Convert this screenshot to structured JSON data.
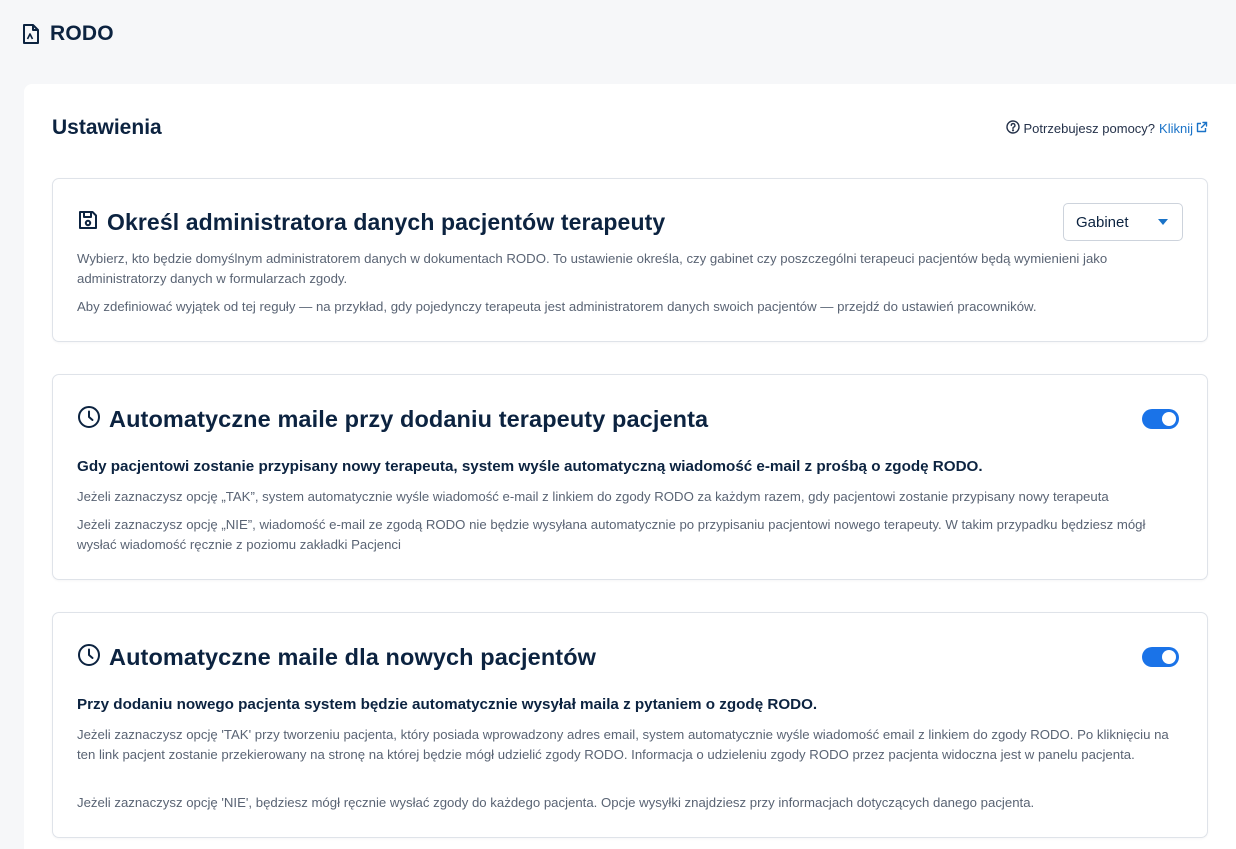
{
  "page": {
    "title": "RODO"
  },
  "settings": {
    "title": "Ustawienia",
    "help_text": "Potrzebujesz pomocy?",
    "help_link": "Kliknij"
  },
  "cards": [
    {
      "title": "Określ administratora danych pacjentów terapeuty",
      "select_value": "Gabinet",
      "paragraphs": [
        "Wybierz, kto będzie domyślnym administratorem danych w dokumentach RODO. To ustawienie określa, czy gabinet czy poszczególni terapeuci pacjentów będą wymienieni jako administratorzy danych w formularzach zgody.",
        "Aby zdefiniować wyjątek od tej reguły — na przykład, gdy pojedynczy terapeuta jest administratorem danych swoich pacjentów — przejdź do ustawień pracowników."
      ]
    },
    {
      "title": "Automatyczne maile przy dodaniu terapeuty pacjenta",
      "toggle_on": true,
      "lead": "Gdy pacjentowi zostanie przypisany nowy terapeuta, system wyśle automatyczną wiadomość e-mail z prośbą o zgodę RODO.",
      "paragraphs": [
        "Jeżeli zaznaczysz opcję „TAK”, system automatycznie wyśle wiadomość e-mail z linkiem do zgody RODO za każdym razem, gdy pacjentowi zostanie przypisany nowy terapeuta",
        "Jeżeli zaznaczysz opcję „NIE”, wiadomość e-mail ze zgodą RODO nie będzie wysyłana automatycznie po przypisaniu pacjentowi nowego terapeuty. W takim przypadku będziesz mógł wysłać wiadomość ręcznie z poziomu zakładki Pacjenci"
      ]
    },
    {
      "title": "Automatyczne maile dla nowych pacjentów",
      "toggle_on": true,
      "lead": "Przy dodaniu nowego pacjenta system będzie automatycznie wysyłał maila z pytaniem o zgodę RODO.",
      "paragraphs": [
        "Jeżeli zaznaczysz opcję 'TAK' przy tworzeniu pacjenta, który posiada wprowadzony adres email, system automatycznie wyśle wiadomość email z linkiem do zgody RODO. Po kliknięciu na ten link pacjent zostanie przekierowany na stronę na której będzie mógł udzielić zgody RODO. Informacja o udzieleniu zgody RODO przez pacjenta widoczna jest w panelu pacjenta.",
        "Jeżeli zaznaczysz opcję 'NIE', będziesz mógł ręcznie wysłać zgody do każdego pacjenta. Opcje wysyłki znajdziesz przy informacjach dotyczących danego pacjenta."
      ]
    }
  ],
  "colors": {
    "accent": "#1a73e8",
    "link": "#1a73c8",
    "heading": "#0c2340",
    "text": "#5a6474"
  },
  "icons": {
    "page": "document-icon",
    "help": "question-circle-icon",
    "external": "external-link-icon",
    "card1": "save-icon",
    "card2": "clock-icon",
    "card3": "clock-icon"
  }
}
